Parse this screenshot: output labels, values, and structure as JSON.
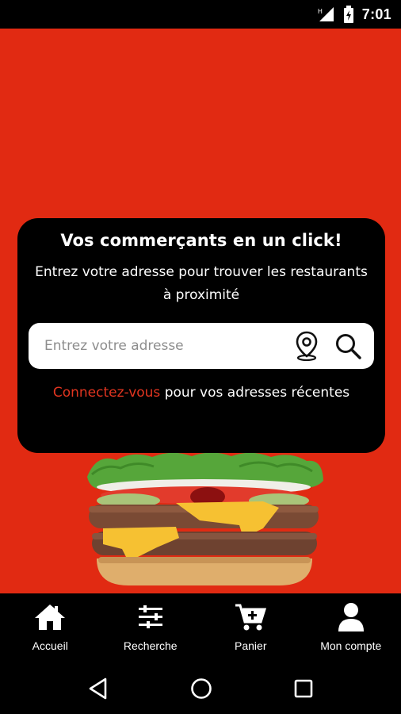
{
  "status_bar": {
    "time": "7:01",
    "icons": [
      "signal-icon",
      "battery-icon"
    ]
  },
  "card": {
    "title": "Vos commerçants en un click!",
    "subtitle": "Entrez votre adresse pour trouver les restaurants à proximité",
    "search": {
      "value": "",
      "placeholder": "Entrez votre adresse",
      "icons": [
        "location-pin-icon",
        "search-icon"
      ]
    },
    "login_link": "Connectez-vous",
    "login_rest": " pour vos adresses récentes"
  },
  "bottom_nav": {
    "items": [
      {
        "label": "Accueil",
        "icon": "home-icon"
      },
      {
        "label": "Recherche",
        "icon": "filters-icon"
      },
      {
        "label": "Panier",
        "icon": "cart-add-icon"
      },
      {
        "label": "Mon compte",
        "icon": "user-icon"
      }
    ]
  },
  "system_nav": [
    "back-icon",
    "home-circle-icon",
    "recents-icon"
  ],
  "colors": {
    "accent": "#e12a12",
    "link": "#e23520",
    "card": "#000000"
  }
}
